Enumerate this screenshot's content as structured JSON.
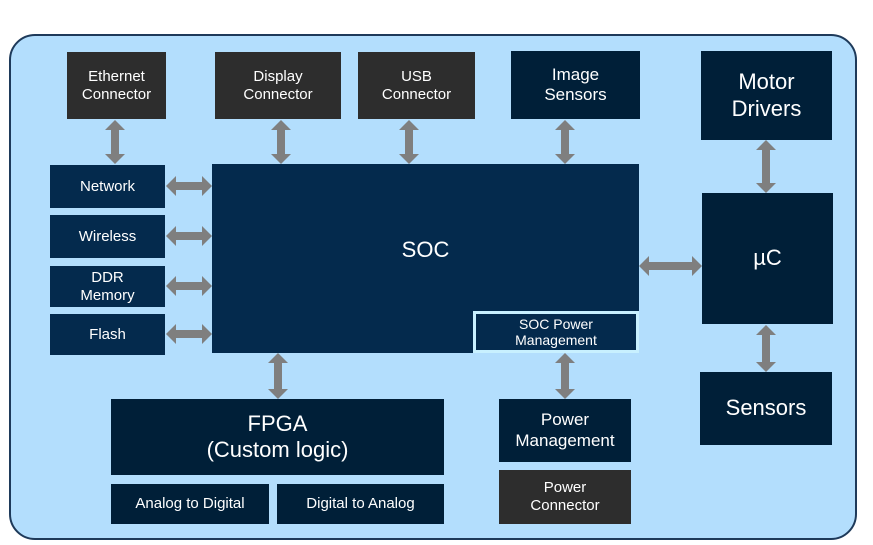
{
  "diagram": {
    "connectors": {
      "ethernet": "Ethernet\nConnector",
      "display": "Display\nConnector",
      "usb": "USB\nConnector",
      "power": "Power\nConnector"
    },
    "image_sensors": "Image\nSensors",
    "motor_drivers": "Motor\nDrivers",
    "microcontroller": "µC",
    "sensors": "Sensors",
    "soc": "SOC",
    "soc_power_management": "SOC Power\nManagement",
    "power_management": "Power\nManagement",
    "peripherals": {
      "network": "Network",
      "wireless": "Wireless",
      "ddr_memory": "DDR\nMemory",
      "flash": "Flash"
    },
    "fpga": "FPGA\n(Custom logic)",
    "adc": "Analog to Digital",
    "dac": "Digital to Analog",
    "colors": {
      "background": "#b3defd",
      "soc_block": "#042a4d",
      "dark_block": "#001f38",
      "connector_block": "#2d2d2d",
      "arrow": "#7f7f7f",
      "highlight_border": "#c8f0ff"
    }
  }
}
